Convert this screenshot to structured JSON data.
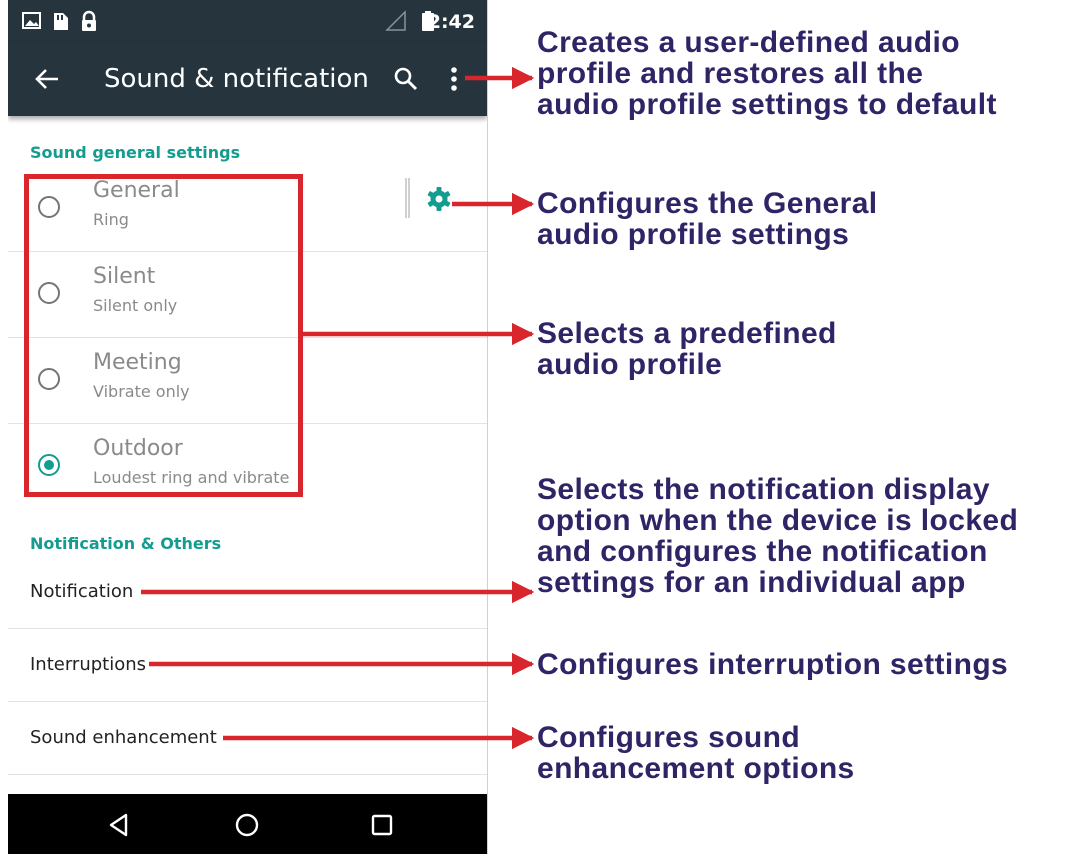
{
  "status_bar": {
    "time": "2:42",
    "left_icons": [
      "image-icon",
      "sd-card-icon",
      "lock-icon"
    ],
    "right_icons": [
      "signal-icon",
      "battery-icon"
    ]
  },
  "app_bar": {
    "title": "Sound & notification",
    "back_icon": "arrow-left-icon",
    "search_icon": "search-icon",
    "overflow_icon": "more-vertical-icon"
  },
  "sound_general": {
    "header": "Sound general settings",
    "profiles": [
      {
        "name": "General",
        "subtitle": "Ring",
        "selected": false,
        "has_settings": true
      },
      {
        "name": "Silent",
        "subtitle": "Silent only",
        "selected": false
      },
      {
        "name": "Meeting",
        "subtitle": "Vibrate only",
        "selected": false
      },
      {
        "name": "Outdoor",
        "subtitle": "Loudest ring and vibrate",
        "selected": true
      }
    ]
  },
  "notification_others": {
    "header": "Notification & Others",
    "items": [
      {
        "label": "Notification"
      },
      {
        "label": "Interruptions"
      },
      {
        "label": "Sound enhancement"
      }
    ]
  },
  "nav_bar": {
    "icons": [
      "back-triangle-icon",
      "home-circle-icon",
      "recents-square-icon"
    ]
  },
  "callouts": [
    {
      "lines": [
        "Creates a user-defined audio",
        "profile and restores all the",
        "audio profile settings to default"
      ]
    },
    {
      "lines": [
        "Configures the General",
        "audio profile settings"
      ]
    },
    {
      "lines": [
        "Selects a predefined",
        "audio profile"
      ]
    },
    {
      "lines": [
        "Selects the notification display",
        "option when the device is locked",
        "and configures the notification",
        "settings for an individual app"
      ]
    },
    {
      "lines": [
        "Configures interruption settings"
      ]
    },
    {
      "lines": [
        "Configures sound",
        "enhancement options"
      ]
    }
  ],
  "colors": {
    "toolbar": "#26353d",
    "accent": "#139c8f",
    "annotation_red": "#d8262c",
    "callout_text": "#2e2466"
  }
}
